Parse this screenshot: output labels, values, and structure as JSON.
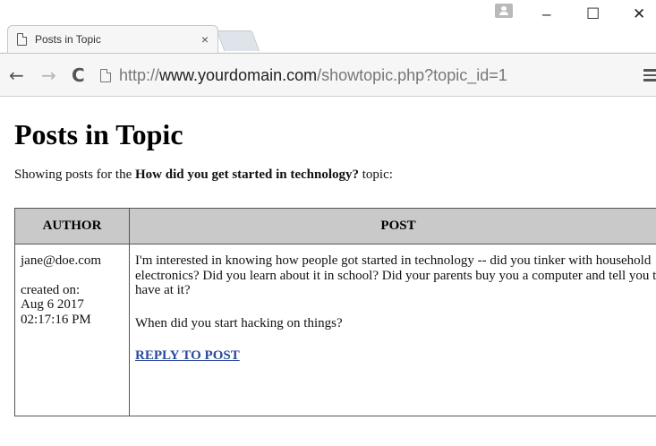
{
  "browser": {
    "tab_title": "Posts in Topic",
    "tab_close": "×",
    "url_scheme": "http://",
    "url_host": "www.yourdomain.com",
    "url_path": "/showtopic.php?topic_id=1",
    "icons": [
      "page-icon",
      "close-icon",
      "back-icon",
      "forward-icon",
      "reload-icon",
      "menu-icon",
      "profile-icon"
    ],
    "window_controls": {
      "minimize": "–",
      "maximize": "☐",
      "close": "✕"
    }
  },
  "page": {
    "heading": "Posts in Topic",
    "intro_prefix": "Showing posts for the ",
    "topic_title": "How did you get started in technology?",
    "intro_suffix": " topic:"
  },
  "table": {
    "columns": [
      "AUTHOR",
      "POST"
    ],
    "rows": [
      {
        "author": "jane@doe.com",
        "created_label": "created on:",
        "created_date": "Aug 6 2017",
        "created_time": "02:17:16 PM",
        "post_p1": "I'm interested in knowing how people got started in technology -- did you tinker with household electronics? Did you learn about it in school? Did your parents buy you a computer and tell you to have at it?",
        "post_p2": "When did you start hacking on things?",
        "reply_label": "REPLY TO POST"
      }
    ]
  }
}
